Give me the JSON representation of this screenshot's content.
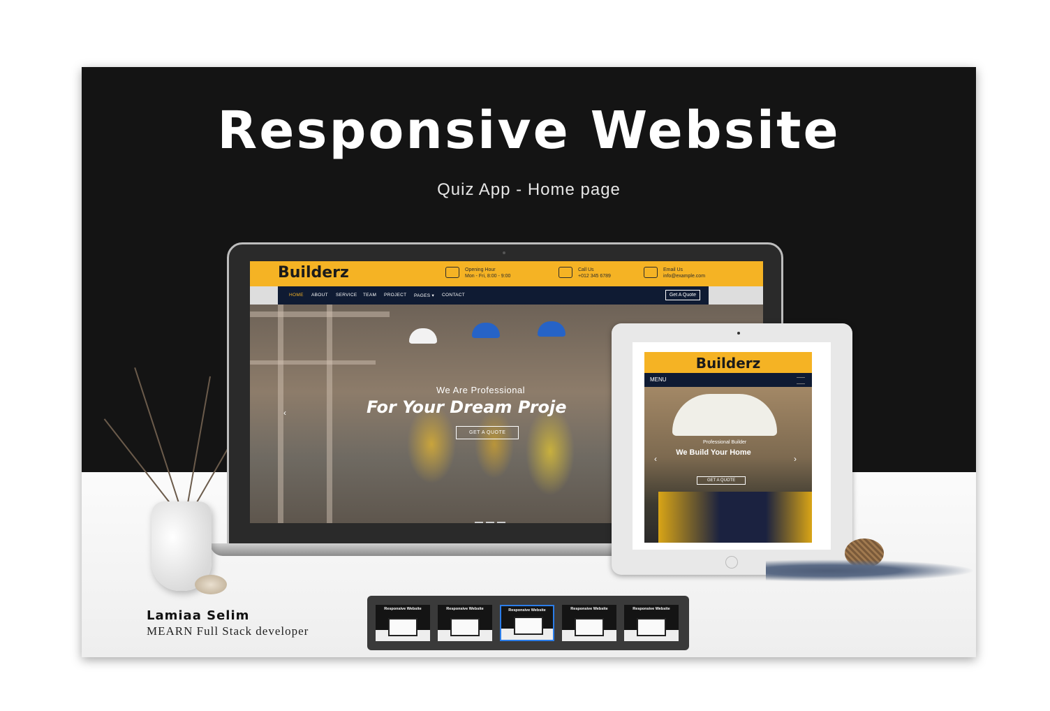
{
  "header": {
    "title": "Responsive Website",
    "subtitle": "Quiz App - Home page"
  },
  "laptop_site": {
    "logo": "Builderz",
    "info": [
      {
        "icon": "clock-icon",
        "label": "Opening Hour",
        "value": "Mon - Fri, 8:00 - 9:00"
      },
      {
        "icon": "phone-icon",
        "label": "Call Us",
        "value": "+012 345 6789"
      },
      {
        "icon": "mail-icon",
        "label": "Email Us",
        "value": "info@example.com"
      }
    ],
    "nav": [
      "HOME",
      "ABOUT",
      "SERVICE",
      "TEAM",
      "PROJECT",
      "PAGES ▾",
      "CONTACT"
    ],
    "quote_button": "Get A Quote",
    "hero_kicker": "We Are Professional",
    "hero_heading": "For Your Dream Proje",
    "hero_button": "GET A QUOTE"
  },
  "tablet_site": {
    "logo": "Builderz",
    "menu": "MENU",
    "hero_kicker": "Professional Builder",
    "hero_heading": "We Build Your Home",
    "hero_button": "GET A QUOTE"
  },
  "author": {
    "name": "Lamiaa Selim",
    "role": "MEARN Full Stack developer"
  },
  "thumbnails": [
    {
      "label": "Responsive Website",
      "selected": false
    },
    {
      "label": "Responsive Website",
      "selected": false
    },
    {
      "label": "Responsive Website",
      "selected": true
    },
    {
      "label": "Responsive Website",
      "selected": false
    },
    {
      "label": "Responsive Website",
      "selected": false
    }
  ],
  "colors": {
    "brand_yellow": "#f5b324",
    "nav_navy": "#0f1b33",
    "selection_blue": "#2b7de9"
  }
}
